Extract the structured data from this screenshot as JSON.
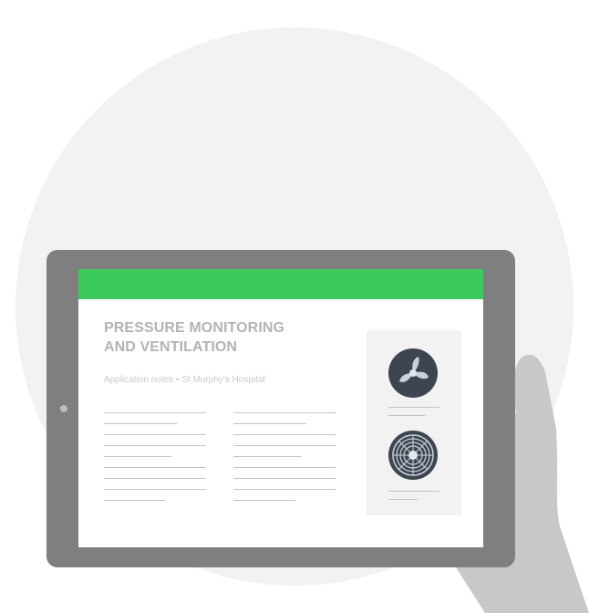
{
  "document": {
    "title": "PRESSURE MONITORING\nAND VENTILATION",
    "subtitle": "Application notes • St Murphy’s Hospital"
  },
  "icons": {
    "fan_top": "fan-blade-icon",
    "fan_bottom": "fan-grille-icon"
  },
  "colors": {
    "header_green": "#3dca5c",
    "tablet_frame": "#7f7f7f",
    "hand": "#c8c8c8",
    "background_circle": "#f2f2f2",
    "fan_dark": "#3d4550"
  }
}
